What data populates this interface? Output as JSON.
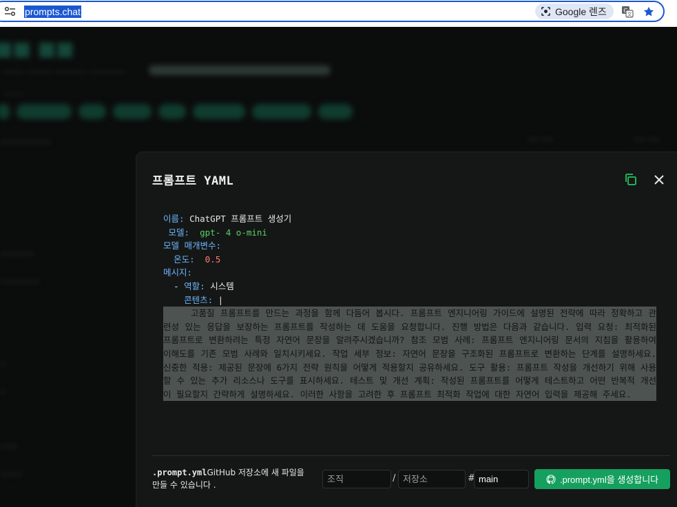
{
  "browser": {
    "url": "prompts.chat",
    "lens_label": "Google 렌즈"
  },
  "modal": {
    "title": "프롬프트 YAML",
    "yaml": {
      "name_key": "이름:",
      "name_value": "ChatGPT 프롬프트 생성기",
      "model_key": "모델:",
      "model_value": "gpt- 4 o-mini",
      "params_key": "모델 매개변수:",
      "temp_key": "온도:",
      "temp_value": "0.5",
      "messages_key": "메시지:",
      "dash": "-",
      "role_key": "역할:",
      "role_value": "시스템",
      "content_key": "콘텐츠:",
      "content_marker": "|",
      "content_text": "고품질 프롬프트를 만드는 과정을 함께 다듬어 봅시다. 프롬프트 엔지니어링 가이드에 설명된 전략에 따라 정확하고 관련성 있는 응답을 보장하는 프롬프트를 작성하는 데 도움을 요청합니다. 진행 방법은 다음과 같습니다. 입력 요청: 최적화된 프롬프트로 변환하려는 특정 자연어 문장을 알려주시겠습니까? 참조 모범 사례: 프롬프트 엔지니어링 문서의 지침을 활용하여 이해도를 기존 모범 사례와 일치시키세요. 작업 세부 정보: 자연어 문장을 구조화된 프롬프트로 변환하는 단계를 설명하세요. 신중한 적용: 제공된 문장에 6가지 전략 원칙을 어떻게 적용할지 공유하세요. 도구 활용: 프롬프트 작성을 개선하기 위해 사용할 수 있는 추가 리소스나 도구를 표시하세요. 테스트 및 개선 계획: 작성된 프롬프트를 어떻게 테스트하고 어떤 반복적 개선이 필요할지 간략하게 설명하세요. 이러한 사항을 고려한 후 프롬프트 최적화 작업에 대한 자연어 입력을 제공해 주세요."
    },
    "footer": {
      "note_file": ".prompt.yml",
      "note_text": "GitHub 저장소에 새 파일을 만들 수 있습니다 .",
      "org_placeholder": "조직",
      "separator": "/",
      "repo_placeholder": "저장소",
      "hash": "#",
      "branch_value": "main",
      "create_button": ".prompt.yml을 생성합니다"
    }
  },
  "colors": {
    "accent": "#16a05f",
    "yaml_key": "#6cb6ff",
    "yaml_string": "#56d364",
    "yaml_number": "#ff7b72"
  }
}
